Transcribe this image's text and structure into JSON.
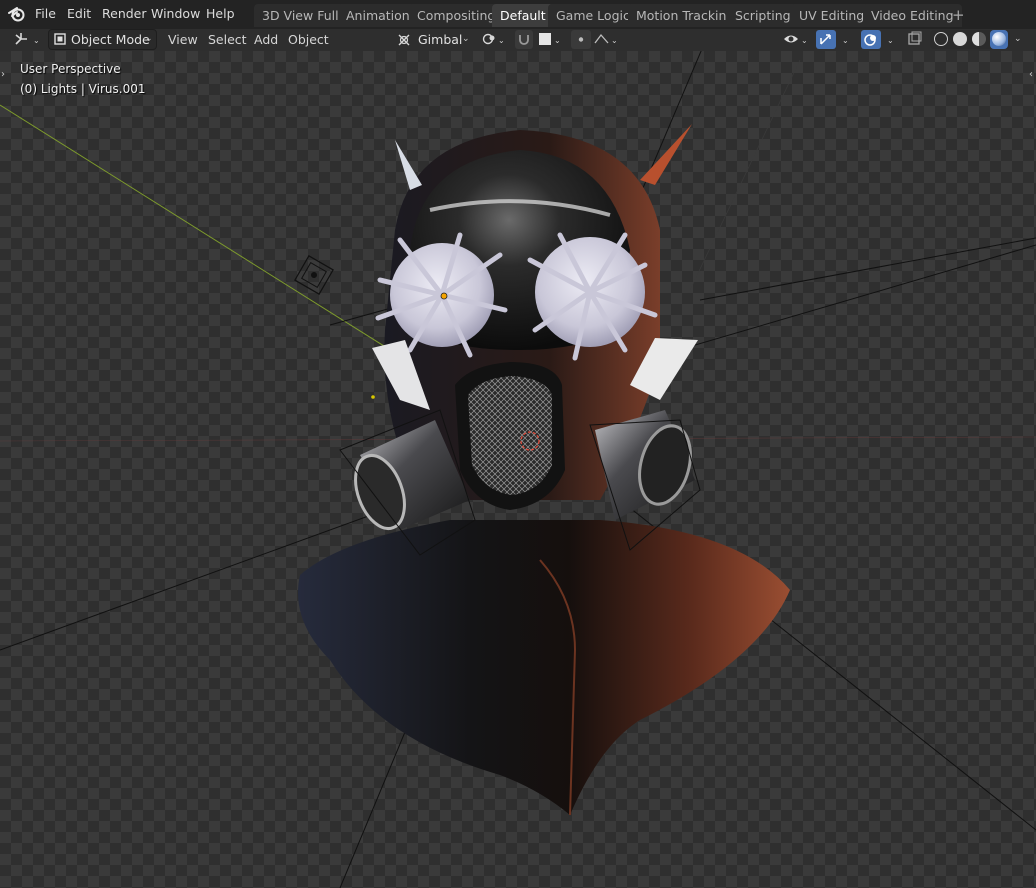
{
  "menubar": {
    "logo_icon": "blender-logo-icon",
    "items": [
      "File",
      "Edit",
      "Render",
      "Window",
      "Help"
    ]
  },
  "workspaces": {
    "tabs": [
      "3D View Full",
      "Animation",
      "Compositing",
      "Default",
      "Game Logic",
      "Motion Tracking",
      "Scripting",
      "UV Editing",
      "Video Editing"
    ],
    "active": "Default",
    "add_label": "+"
  },
  "header": {
    "editor_type_icon": "view3d-editor-icon",
    "mode": "Object Mode",
    "menus": [
      "View",
      "Select",
      "Add",
      "Object"
    ],
    "orientation": "Gimbal",
    "pivot_icon": "pivot-icon",
    "snap_icon": "snap-magnet-icon",
    "proportional_icon": "proportional-edit-icon",
    "visibility_icon": "eye-visibility-icon",
    "gizmo_icon": "gizmo-icon",
    "overlay_icon": "overlay-icon",
    "xray_icon": "xray-icon",
    "shading_modes": [
      "wireframe",
      "solid",
      "material",
      "rendered"
    ],
    "active_shading": "rendered"
  },
  "viewport": {
    "view_name": "User Perspective",
    "object_info": "(0) Lights | Virus.001"
  },
  "colors": {
    "accent": "#4772b3",
    "active_tab": "#3d3d3d",
    "bg": "#232323"
  }
}
